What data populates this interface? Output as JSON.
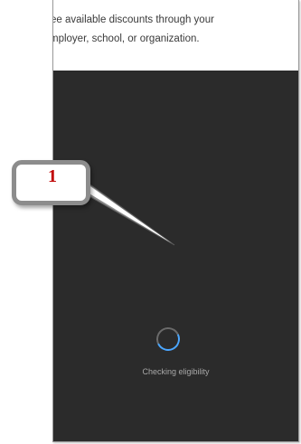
{
  "intro": {
    "line1": "ee available discounts through your",
    "line2": "mployer, school, or organization."
  },
  "loading": {
    "status_text": "Checking eligibility"
  },
  "annotation": {
    "number": "1"
  },
  "colors": {
    "panel": "#2b2b2b",
    "spinner_accent": "#4aa6ff",
    "callout_number": "#c00000"
  }
}
